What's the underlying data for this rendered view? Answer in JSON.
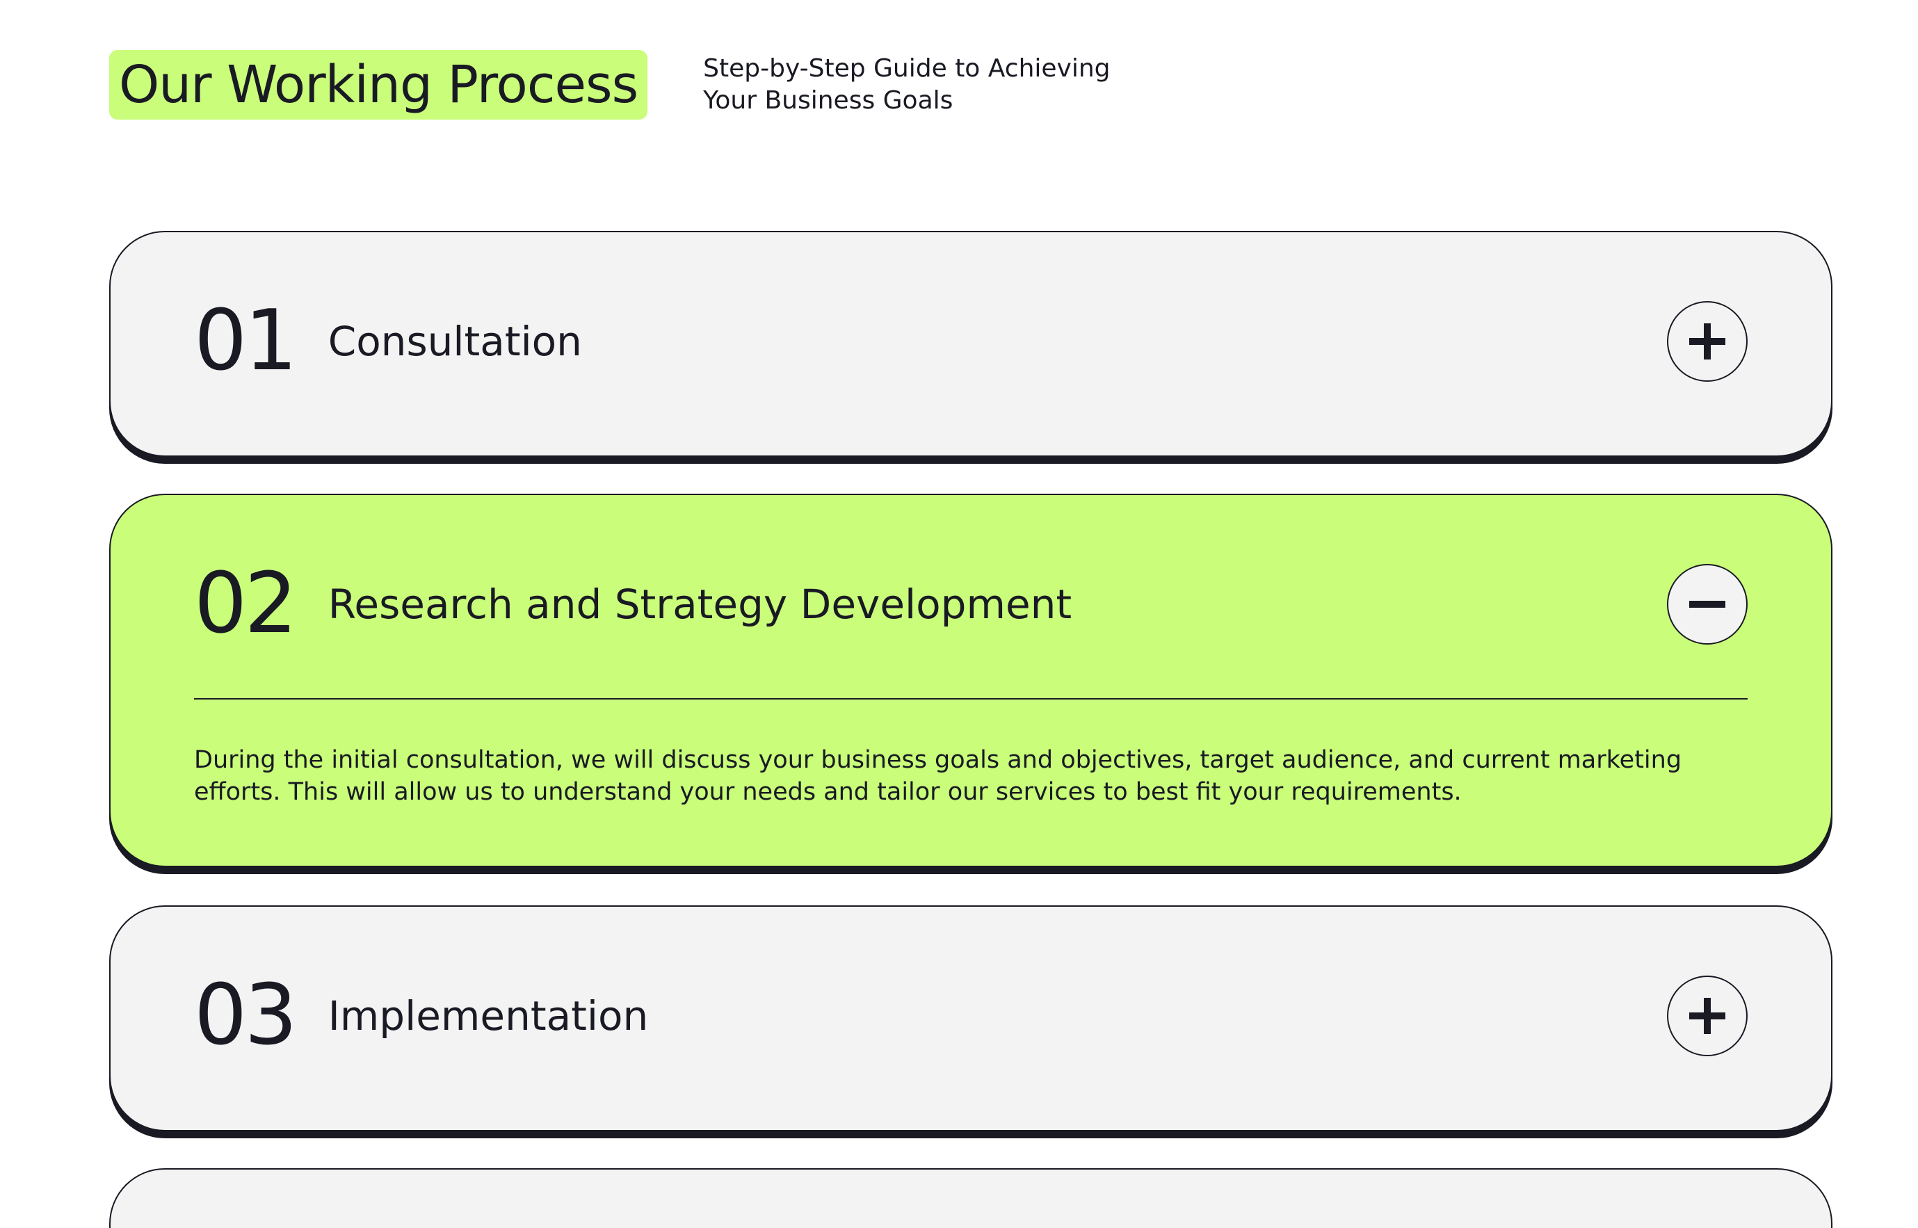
{
  "header": {
    "title": "Our Working Process",
    "subtitle": "Step-by-Step Guide to Achieving Your Business Goals"
  },
  "steps": [
    {
      "number": "01",
      "title": "Consultation",
      "expanded": false,
      "toggle_icon": "plus-icon"
    },
    {
      "number": "02",
      "title": "Research and Strategy Development",
      "expanded": true,
      "toggle_icon": "minus-icon",
      "description": "During the initial consultation, we will discuss your business goals and objectives, target audience, and current marketing efforts. This will allow us to understand your needs and tailor our services to best fit your requirements."
    },
    {
      "number": "03",
      "title": "Implementation",
      "expanded": false,
      "toggle_icon": "plus-icon"
    }
  ],
  "colors": {
    "accent": "#c9fd7a",
    "card_closed": "#f3f3f3",
    "dark": "#191a23"
  }
}
